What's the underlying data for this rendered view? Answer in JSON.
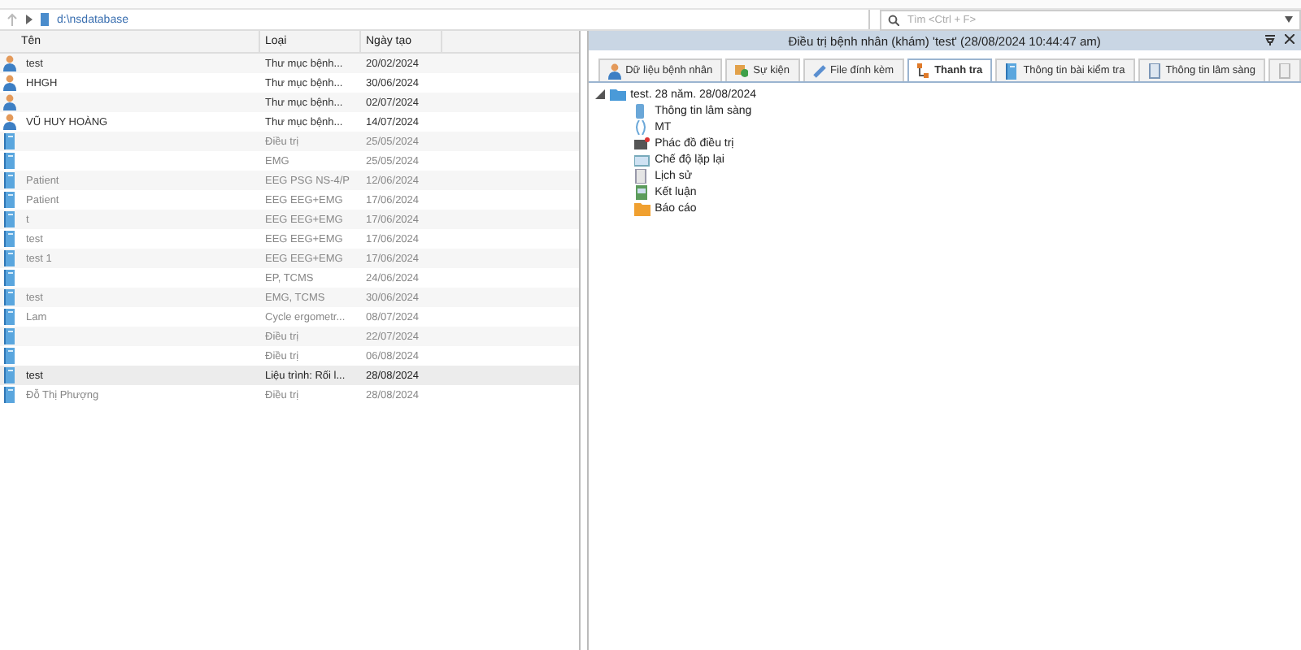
{
  "path_bar": {
    "path": "d:\\nsdatabase"
  },
  "search": {
    "placeholder": "Tìm <Ctrl + F>"
  },
  "table": {
    "columns": [
      "Tên",
      "Loại",
      "Ngày tạo"
    ],
    "rows": [
      {
        "kind": "patient",
        "name": "test",
        "type": "Thư mục bệnh...",
        "date": "20/02/2024",
        "selected": false
      },
      {
        "kind": "patient",
        "name": "HHGH",
        "type": "Thư mục bệnh...",
        "date": "30/06/2024",
        "selected": false
      },
      {
        "kind": "patient",
        "type": "Thư mục bệnh...",
        "date": "02/07/2024",
        "selected": false
      },
      {
        "kind": "patient",
        "name": "VŨ HUY HOÀNG",
        "type": "Thư mục bệnh...",
        "date": "14/07/2024",
        "selected": false
      },
      {
        "kind": "exam",
        "type": "Điều trị",
        "date": "25/05/2024",
        "selected": false
      },
      {
        "kind": "exam",
        "type": "EMG",
        "date": "25/05/2024",
        "selected": false
      },
      {
        "kind": "exam",
        "name": "Patient",
        "type": "EEG PSG NS-4/P",
        "date": "12/06/2024",
        "selected": false
      },
      {
        "kind": "exam",
        "name": "Patient",
        "type": "EEG EEG+EMG",
        "date": "17/06/2024",
        "selected": false
      },
      {
        "kind": "exam",
        "name": "t",
        "type": "EEG EEG+EMG",
        "date": "17/06/2024",
        "selected": false
      },
      {
        "kind": "exam",
        "name": "test",
        "type": "EEG EEG+EMG",
        "date": "17/06/2024",
        "selected": false
      },
      {
        "kind": "exam",
        "name": "test 1",
        "type": "EEG EEG+EMG",
        "date": "17/06/2024",
        "selected": false
      },
      {
        "kind": "exam",
        "type": "EP, TCMS",
        "date": "24/06/2024",
        "selected": false
      },
      {
        "kind": "exam",
        "name": "test",
        "type": "EMG, TCMS",
        "date": "30/06/2024",
        "selected": false
      },
      {
        "kind": "exam",
        "name": "Lam",
        "type": "Cycle ergometr...",
        "date": "08/07/2024",
        "selected": false
      },
      {
        "kind": "exam",
        "type": "Điều trị",
        "date": "22/07/2024",
        "selected": false
      },
      {
        "kind": "exam",
        "type": "Điều trị",
        "date": "06/08/2024",
        "selected": false
      },
      {
        "kind": "exam",
        "name": "test",
        "type": "Liệu trình: Rối l...",
        "date": "28/08/2024",
        "selected": true
      },
      {
        "kind": "exam",
        "name": "Đỗ Thị Phượng",
        "type": "Điều trị",
        "date": "28/08/2024",
        "selected": false
      }
    ]
  },
  "panel": {
    "title": "Điều trị bệnh nhân (khám) 'test' (28/08/2024 10:44:47 am)",
    "tabs": [
      {
        "label": "Dữ liệu bệnh nhân",
        "selected": false
      },
      {
        "label": "Sự kiện",
        "selected": false
      },
      {
        "label": "File đính kèm",
        "selected": false
      },
      {
        "label": "Thanh tra",
        "selected": true
      },
      {
        "label": "Thông tin bài kiểm tra",
        "selected": false
      },
      {
        "label": "Thông tin lâm sàng",
        "selected": false
      },
      {
        "selected": false
      }
    ],
    "tree": {
      "label": "test. 28 năm. 28/08/2024",
      "expanded": true,
      "children": [
        {
          "label": "Thông tin lâm sàng"
        },
        {
          "label": "MT"
        },
        {
          "label": "Phác đồ điều trị"
        },
        {
          "label": "Chế độ lặp lại"
        },
        {
          "label": "Lịch sử"
        },
        {
          "label": "Kết luận"
        },
        {
          "label": "Báo cáo"
        }
      ]
    }
  }
}
